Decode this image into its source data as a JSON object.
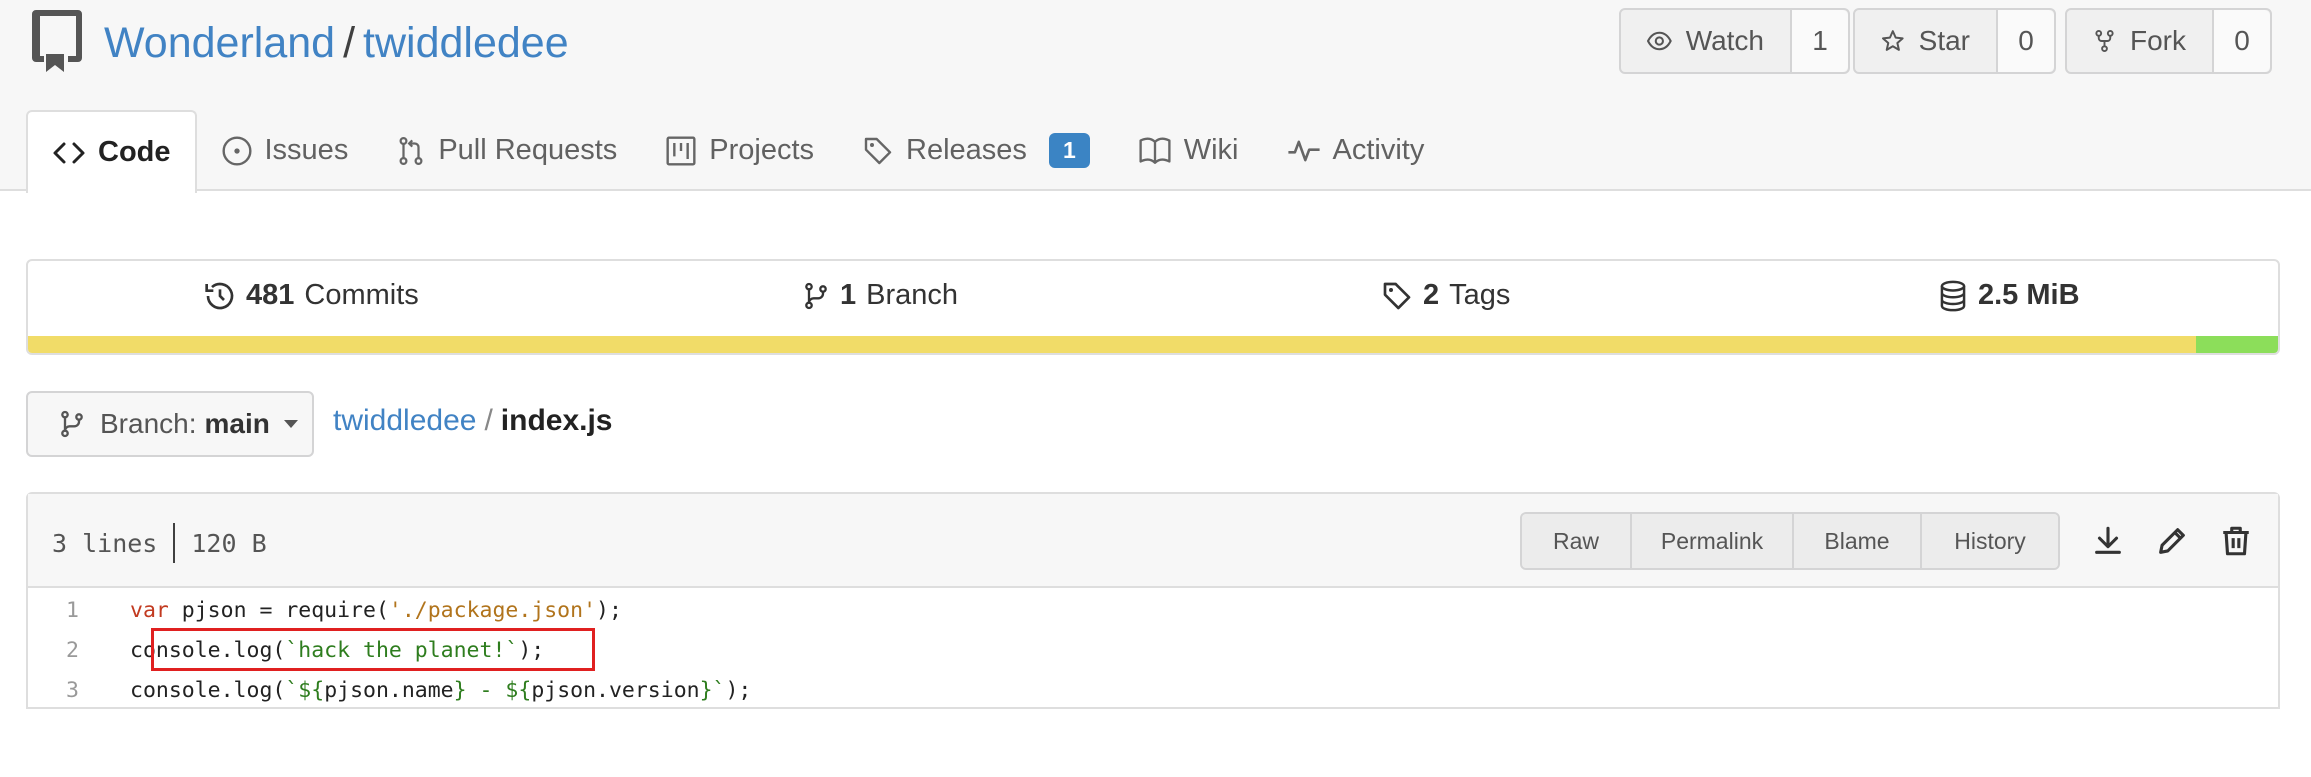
{
  "repo": {
    "owner": "Wonderland",
    "separator": "/",
    "name": "twiddledee"
  },
  "actions": {
    "watch": {
      "label": "Watch",
      "count": "1"
    },
    "star": {
      "label": "Star",
      "count": "0"
    },
    "fork": {
      "label": "Fork",
      "count": "0"
    }
  },
  "tabs": [
    {
      "label": "Code",
      "icon": "code-icon",
      "active": true
    },
    {
      "label": "Issues",
      "icon": "issue-icon"
    },
    {
      "label": "Pull Requests",
      "icon": "pull-request-icon"
    },
    {
      "label": "Projects",
      "icon": "project-icon"
    },
    {
      "label": "Releases",
      "icon": "tag-icon",
      "badge": "1"
    },
    {
      "label": "Wiki",
      "icon": "book-icon"
    },
    {
      "label": "Activity",
      "icon": "pulse-icon"
    }
  ],
  "stats": {
    "commits": {
      "value": "481",
      "label": "Commits"
    },
    "branches": {
      "value": "1",
      "label": "Branch"
    },
    "tags": {
      "value": "2",
      "label": "Tags"
    },
    "size": {
      "value": "2.5 MiB",
      "label": ""
    }
  },
  "language_bar": [
    {
      "color": "#f1dc68",
      "share": 0.962
    },
    {
      "color": "#8cde5a",
      "share": 0.038
    }
  ],
  "branch": {
    "label": "Branch:",
    "value": "main"
  },
  "breadcrumb": {
    "repo": "twiddledee",
    "separator": "/",
    "file": "index.js"
  },
  "file": {
    "lines": "3 lines",
    "size": "120 B",
    "buttons": [
      "Raw",
      "Permalink",
      "Blame",
      "History"
    ],
    "icons": [
      "download-icon",
      "edit-icon",
      "delete-icon"
    ],
    "code": [
      {
        "num": "1",
        "tokens": [
          {
            "t": "var",
            "c": "kw"
          },
          {
            "t": " pjson = require(",
            "c": ""
          },
          {
            "t": "'./package.json'",
            "c": "str"
          },
          {
            "t": ");",
            "c": ""
          }
        ]
      },
      {
        "num": "2",
        "tokens": [
          {
            "t": "console.log(",
            "c": ""
          },
          {
            "t": "`hack the planet!`",
            "c": "tpl"
          },
          {
            "t": ");",
            "c": ""
          }
        ]
      },
      {
        "num": "3",
        "tokens": [
          {
            "t": "console.log(",
            "c": ""
          },
          {
            "t": "`${",
            "c": "tpl"
          },
          {
            "t": "pjson.name",
            "c": ""
          },
          {
            "t": "} - ${",
            "c": "tpl"
          },
          {
            "t": "pjson.version",
            "c": ""
          },
          {
            "t": "}`",
            "c": "tpl"
          },
          {
            "t": ");",
            "c": ""
          }
        ]
      }
    ]
  }
}
